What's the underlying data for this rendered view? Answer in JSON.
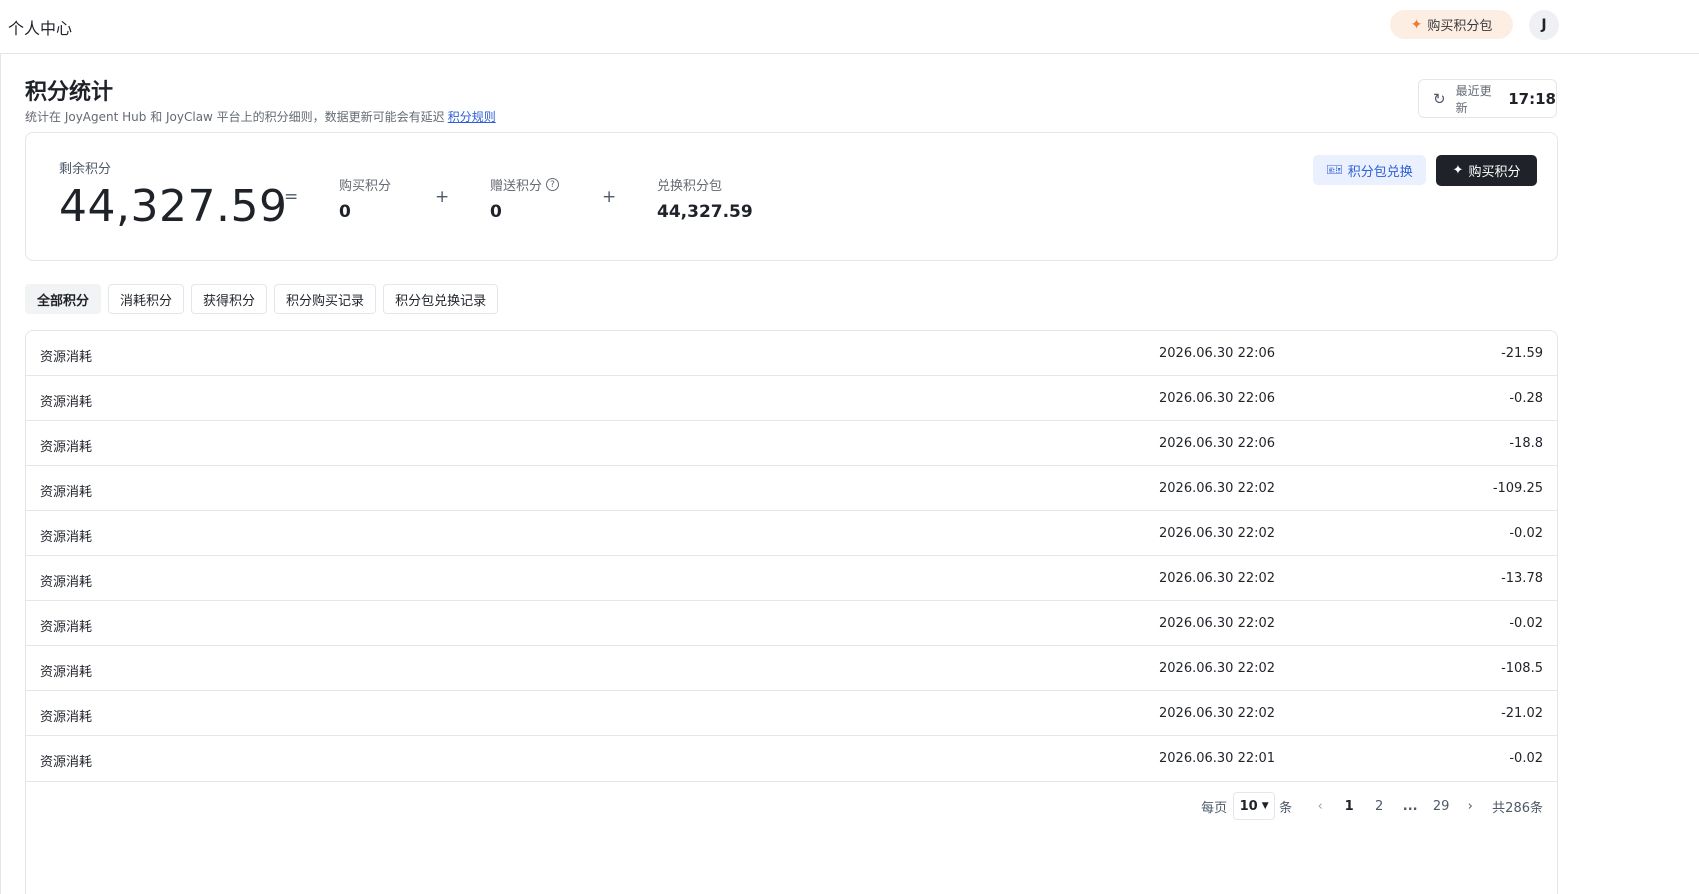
{
  "header": {
    "title": "个人中心",
    "buy_pack_label": "购买积分包",
    "avatar_initial": "J"
  },
  "page": {
    "title": "积分统计",
    "description": "统计在 JoyAgent Hub 和 JoyClaw 平台上的积分细则，数据更新可能会有延迟",
    "rules_link": "积分规则",
    "update_label": "最近更新",
    "update_time": "17:18"
  },
  "summary": {
    "remain_label": "剩余积分",
    "remain_value": "44,327.59",
    "equals": "=",
    "plus": "+",
    "purchased_label": "购买积分",
    "purchased_value": "0",
    "gifted_label": "赠送积分",
    "gifted_value": "0",
    "exchanged_label": "兑换积分包",
    "exchanged_value": "44,327.59",
    "exchange_button": "积分包兑换",
    "buy_button": "购买积分"
  },
  "tabs": [
    {
      "label": "全部积分"
    },
    {
      "label": "消耗积分"
    },
    {
      "label": "获得积分"
    },
    {
      "label": "积分购买记录"
    },
    {
      "label": "积分包兑换记录"
    }
  ],
  "records": [
    {
      "type": "资源消耗",
      "time": "2026.06.30 22:06",
      "amount": "-21.59"
    },
    {
      "type": "资源消耗",
      "time": "2026.06.30 22:06",
      "amount": "-0.28"
    },
    {
      "type": "资源消耗",
      "time": "2026.06.30 22:06",
      "amount": "-18.8"
    },
    {
      "type": "资源消耗",
      "time": "2026.06.30 22:02",
      "amount": "-109.25"
    },
    {
      "type": "资源消耗",
      "time": "2026.06.30 22:02",
      "amount": "-0.02"
    },
    {
      "type": "资源消耗",
      "time": "2026.06.30 22:02",
      "amount": "-13.78"
    },
    {
      "type": "资源消耗",
      "time": "2026.06.30 22:02",
      "amount": "-0.02"
    },
    {
      "type": "资源消耗",
      "time": "2026.06.30 22:02",
      "amount": "-108.5"
    },
    {
      "type": "资源消耗",
      "time": "2026.06.30 22:02",
      "amount": "-21.02"
    },
    {
      "type": "资源消耗",
      "time": "2026.06.30 22:01",
      "amount": "-0.02"
    }
  ],
  "pagination": {
    "per_page_label": "每页",
    "page_size": "10",
    "unit": "条",
    "pages": [
      "1",
      "2"
    ],
    "ellipsis": "...",
    "last_page": "29",
    "total": "共286条"
  }
}
